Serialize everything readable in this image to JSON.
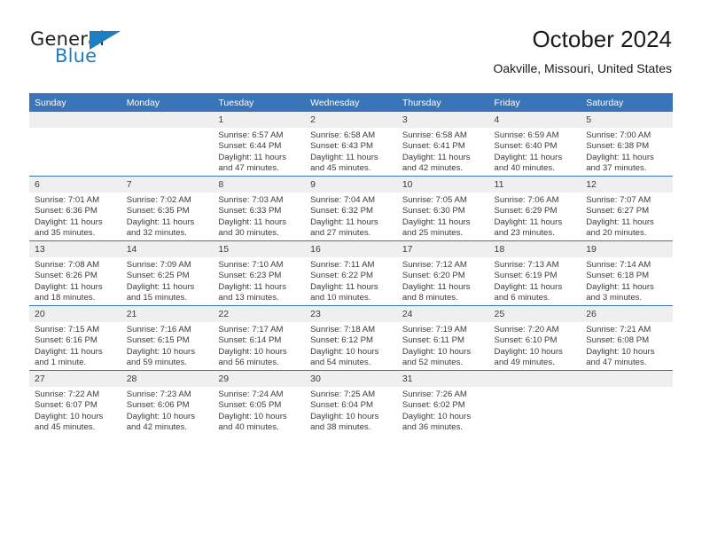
{
  "brand": {
    "name_part1": "General",
    "name_part2": "Blue",
    "accent_color": "#1f7dc4",
    "flag_icon": "triangle-flag-icon"
  },
  "header": {
    "title": "October 2024",
    "subtitle": "Oakville, Missouri, United States"
  },
  "theme": {
    "header_blue": "#3a74b9",
    "daynum_gray": "#efefef",
    "text": "#3c3c3c"
  },
  "weekday_headers": [
    "Sunday",
    "Monday",
    "Tuesday",
    "Wednesday",
    "Thursday",
    "Friday",
    "Saturday"
  ],
  "labels": {
    "sunrise": "Sunrise:",
    "sunset": "Sunset:",
    "daylight": "Daylight:"
  },
  "weeks": [
    [
      {
        "day": "",
        "empty": true
      },
      {
        "day": "",
        "empty": true
      },
      {
        "day": "1",
        "sunrise": "Sunrise: 6:57 AM",
        "sunset": "Sunset: 6:44 PM",
        "daylight": "Daylight: 11 hours and 47 minutes."
      },
      {
        "day": "2",
        "sunrise": "Sunrise: 6:58 AM",
        "sunset": "Sunset: 6:43 PM",
        "daylight": "Daylight: 11 hours and 45 minutes."
      },
      {
        "day": "3",
        "sunrise": "Sunrise: 6:58 AM",
        "sunset": "Sunset: 6:41 PM",
        "daylight": "Daylight: 11 hours and 42 minutes."
      },
      {
        "day": "4",
        "sunrise": "Sunrise: 6:59 AM",
        "sunset": "Sunset: 6:40 PM",
        "daylight": "Daylight: 11 hours and 40 minutes."
      },
      {
        "day": "5",
        "sunrise": "Sunrise: 7:00 AM",
        "sunset": "Sunset: 6:38 PM",
        "daylight": "Daylight: 11 hours and 37 minutes."
      }
    ],
    [
      {
        "day": "6",
        "sunrise": "Sunrise: 7:01 AM",
        "sunset": "Sunset: 6:36 PM",
        "daylight": "Daylight: 11 hours and 35 minutes."
      },
      {
        "day": "7",
        "sunrise": "Sunrise: 7:02 AM",
        "sunset": "Sunset: 6:35 PM",
        "daylight": "Daylight: 11 hours and 32 minutes."
      },
      {
        "day": "8",
        "sunrise": "Sunrise: 7:03 AM",
        "sunset": "Sunset: 6:33 PM",
        "daylight": "Daylight: 11 hours and 30 minutes."
      },
      {
        "day": "9",
        "sunrise": "Sunrise: 7:04 AM",
        "sunset": "Sunset: 6:32 PM",
        "daylight": "Daylight: 11 hours and 27 minutes."
      },
      {
        "day": "10",
        "sunrise": "Sunrise: 7:05 AM",
        "sunset": "Sunset: 6:30 PM",
        "daylight": "Daylight: 11 hours and 25 minutes."
      },
      {
        "day": "11",
        "sunrise": "Sunrise: 7:06 AM",
        "sunset": "Sunset: 6:29 PM",
        "daylight": "Daylight: 11 hours and 23 minutes."
      },
      {
        "day": "12",
        "sunrise": "Sunrise: 7:07 AM",
        "sunset": "Sunset: 6:27 PM",
        "daylight": "Daylight: 11 hours and 20 minutes."
      }
    ],
    [
      {
        "day": "13",
        "sunrise": "Sunrise: 7:08 AM",
        "sunset": "Sunset: 6:26 PM",
        "daylight": "Daylight: 11 hours and 18 minutes."
      },
      {
        "day": "14",
        "sunrise": "Sunrise: 7:09 AM",
        "sunset": "Sunset: 6:25 PM",
        "daylight": "Daylight: 11 hours and 15 minutes."
      },
      {
        "day": "15",
        "sunrise": "Sunrise: 7:10 AM",
        "sunset": "Sunset: 6:23 PM",
        "daylight": "Daylight: 11 hours and 13 minutes."
      },
      {
        "day": "16",
        "sunrise": "Sunrise: 7:11 AM",
        "sunset": "Sunset: 6:22 PM",
        "daylight": "Daylight: 11 hours and 10 minutes."
      },
      {
        "day": "17",
        "sunrise": "Sunrise: 7:12 AM",
        "sunset": "Sunset: 6:20 PM",
        "daylight": "Daylight: 11 hours and 8 minutes."
      },
      {
        "day": "18",
        "sunrise": "Sunrise: 7:13 AM",
        "sunset": "Sunset: 6:19 PM",
        "daylight": "Daylight: 11 hours and 6 minutes."
      },
      {
        "day": "19",
        "sunrise": "Sunrise: 7:14 AM",
        "sunset": "Sunset: 6:18 PM",
        "daylight": "Daylight: 11 hours and 3 minutes."
      }
    ],
    [
      {
        "day": "20",
        "sunrise": "Sunrise: 7:15 AM",
        "sunset": "Sunset: 6:16 PM",
        "daylight": "Daylight: 11 hours and 1 minute."
      },
      {
        "day": "21",
        "sunrise": "Sunrise: 7:16 AM",
        "sunset": "Sunset: 6:15 PM",
        "daylight": "Daylight: 10 hours and 59 minutes."
      },
      {
        "day": "22",
        "sunrise": "Sunrise: 7:17 AM",
        "sunset": "Sunset: 6:14 PM",
        "daylight": "Daylight: 10 hours and 56 minutes."
      },
      {
        "day": "23",
        "sunrise": "Sunrise: 7:18 AM",
        "sunset": "Sunset: 6:12 PM",
        "daylight": "Daylight: 10 hours and 54 minutes."
      },
      {
        "day": "24",
        "sunrise": "Sunrise: 7:19 AM",
        "sunset": "Sunset: 6:11 PM",
        "daylight": "Daylight: 10 hours and 52 minutes."
      },
      {
        "day": "25",
        "sunrise": "Sunrise: 7:20 AM",
        "sunset": "Sunset: 6:10 PM",
        "daylight": "Daylight: 10 hours and 49 minutes."
      },
      {
        "day": "26",
        "sunrise": "Sunrise: 7:21 AM",
        "sunset": "Sunset: 6:08 PM",
        "daylight": "Daylight: 10 hours and 47 minutes."
      }
    ],
    [
      {
        "day": "27",
        "sunrise": "Sunrise: 7:22 AM",
        "sunset": "Sunset: 6:07 PM",
        "daylight": "Daylight: 10 hours and 45 minutes."
      },
      {
        "day": "28",
        "sunrise": "Sunrise: 7:23 AM",
        "sunset": "Sunset: 6:06 PM",
        "daylight": "Daylight: 10 hours and 42 minutes."
      },
      {
        "day": "29",
        "sunrise": "Sunrise: 7:24 AM",
        "sunset": "Sunset: 6:05 PM",
        "daylight": "Daylight: 10 hours and 40 minutes."
      },
      {
        "day": "30",
        "sunrise": "Sunrise: 7:25 AM",
        "sunset": "Sunset: 6:04 PM",
        "daylight": "Daylight: 10 hours and 38 minutes."
      },
      {
        "day": "31",
        "sunrise": "Sunrise: 7:26 AM",
        "sunset": "Sunset: 6:02 PM",
        "daylight": "Daylight: 10 hours and 36 minutes."
      },
      {
        "day": "",
        "empty": true
      },
      {
        "day": "",
        "empty": true
      }
    ]
  ]
}
